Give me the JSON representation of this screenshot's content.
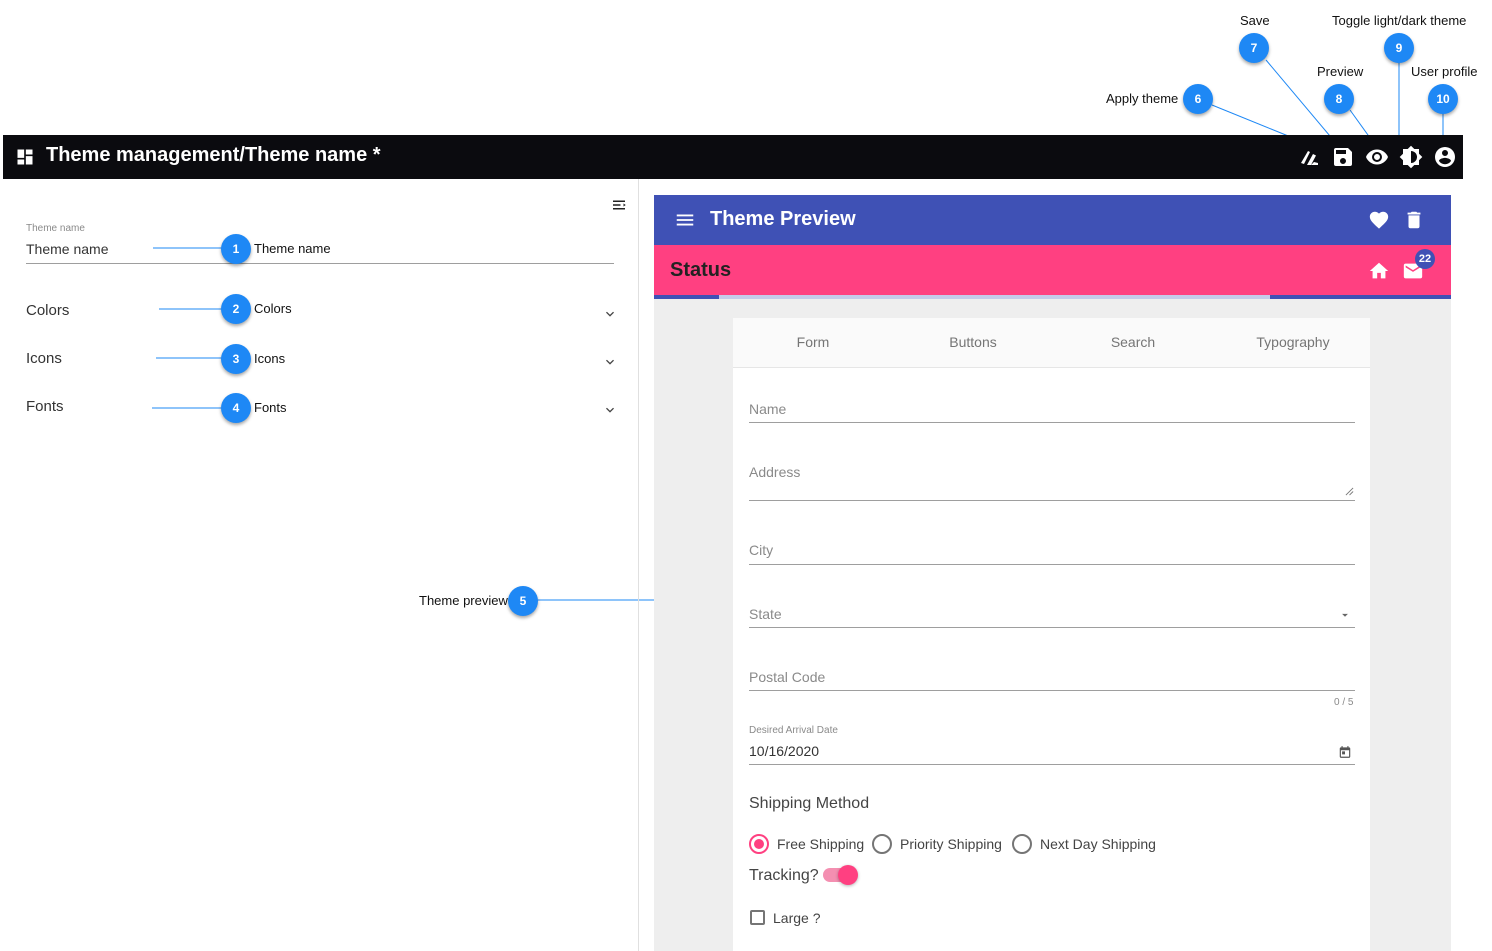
{
  "app_bar": {
    "title": "Theme management/Theme name *",
    "icons": [
      "dashboard-icon",
      "apply-theme-icon",
      "save-icon",
      "preview-icon",
      "brightness-icon",
      "account-icon"
    ]
  },
  "left_panel": {
    "theme_name_label": "Theme name",
    "theme_name_value": "Theme name",
    "sections": [
      {
        "label": "Colors"
      },
      {
        "label": "Icons"
      },
      {
        "label": "Fonts"
      }
    ]
  },
  "callouts": {
    "c1": {
      "num": "1",
      "text": "Theme name"
    },
    "c2": {
      "num": "2",
      "text": "Colors"
    },
    "c3": {
      "num": "3",
      "text": "Icons"
    },
    "c4": {
      "num": "4",
      "text": "Fonts"
    },
    "c5": {
      "num": "5",
      "text": "Theme preview"
    },
    "c6": {
      "num": "6",
      "text": "Apply theme"
    },
    "c7": {
      "num": "7",
      "text": "Save"
    },
    "c8": {
      "num": "8",
      "text": "Preview"
    },
    "c9": {
      "num": "9",
      "text": "Toggle light/dark theme"
    },
    "c10": {
      "num": "10",
      "text": "User profile"
    }
  },
  "preview": {
    "toolbar_title": "Theme Preview",
    "status_title": "Status",
    "mail_badge": "22",
    "tabs": [
      "Form",
      "Buttons",
      "Search",
      "Typography"
    ],
    "form": {
      "name_label": "Name",
      "address_label": "Address",
      "city_label": "City",
      "state_label": "State",
      "postal_label": "Postal Code",
      "postal_counter": "0 / 5",
      "date_label": "Desired Arrival Date",
      "date_value": "10/16/2020",
      "shipping_title": "Shipping Method",
      "shipping_options": [
        "Free Shipping",
        "Priority Shipping",
        "Next Day Shipping"
      ],
      "shipping_selected": "Free Shipping",
      "tracking_label": "Tracking?",
      "tracking_on": true,
      "large_label": "Large ?"
    }
  },
  "colors": {
    "app_bar": "#0b0b0f",
    "primary": "#3f51b5",
    "accent": "#ff4081",
    "callout": "#1e88f5"
  }
}
